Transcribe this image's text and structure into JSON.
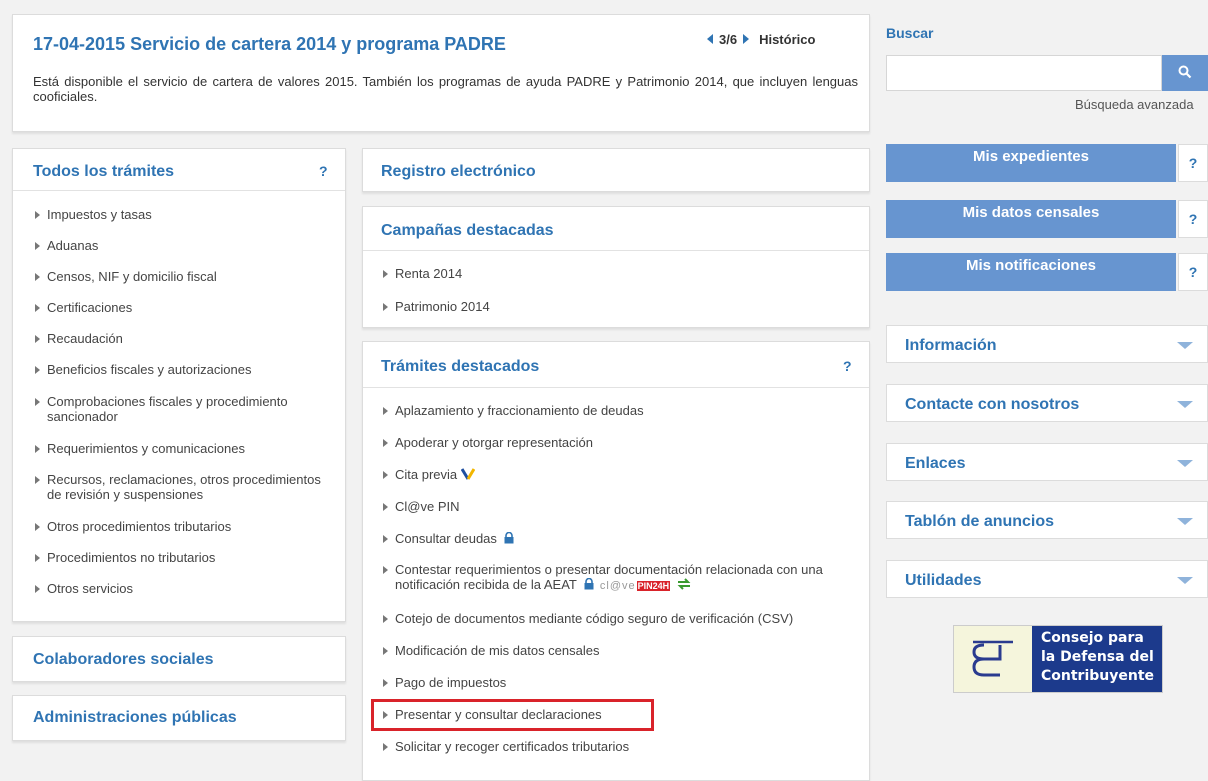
{
  "news": {
    "title": "17-04-2015 Servicio de cartera 2014 y programa PADRE",
    "pager": "3/6",
    "historico": "Histórico",
    "body": "Está disponible el servicio de cartera de valores 2015. También los programas de ayuda PADRE y Patrimonio 2014, que incluyen lenguas cooficiales."
  },
  "search": {
    "label": "Buscar",
    "placeholder": "",
    "advanced": "Búsqueda avanzada"
  },
  "left": {
    "title": "Todos los trámites",
    "help": "?",
    "items": [
      "Impuestos y tasas",
      "Aduanas",
      "Censos, NIF y domicilio fiscal",
      "Certificaciones",
      "Recaudación",
      "Beneficios fiscales y autorizaciones",
      "Comprobaciones fiscales y procedimiento sancionador",
      "Requerimientos y comunicaciones",
      "Recursos, reclamaciones, otros procedimientos de revisión y suspensiones",
      "Otros procedimientos tributarios",
      "Procedimientos no tributarios",
      "Otros servicios"
    ],
    "colaboradores": "Colaboradores sociales",
    "administraciones": "Administraciones públicas"
  },
  "middle": {
    "registro": "Registro electrónico",
    "campanas": {
      "title": "Campañas destacadas",
      "items": [
        "Renta 2014",
        "Patrimonio 2014"
      ]
    },
    "tramites": {
      "title": "Trámites destacados",
      "help": "?",
      "items": [
        "Aplazamiento y fraccionamiento de deudas",
        "Apoderar y otorgar representación",
        "Cita previa",
        "Cl@ve PIN",
        "Consultar deudas",
        "Contestar requerimientos o presentar documentación relacionada con una notificación recibida de la AEAT",
        "Cotejo de documentos mediante código seguro de verificación (CSV)",
        "Modificación de mis datos censales",
        "Pago de impuestos",
        "Presentar y consultar declaraciones",
        "Solicitar y recoger certificados tributarios"
      ],
      "clave_logo": "cl@ve",
      "pin24_logo": "PIN24H"
    }
  },
  "right": {
    "buttons": [
      "Mis expedientes",
      "Mis datos censales",
      "Mis notificaciones"
    ],
    "help": "?",
    "accordions": [
      "Información",
      "Contacte con nosotros",
      "Enlaces",
      "Tablón de anuncios",
      "Utilidades"
    ],
    "banner": "Consejo para la Defensa del Contribuyente"
  },
  "colors": {
    "link_blue": "#2f74b3",
    "button_blue": "#6795d0",
    "highlight_red": "#d9232a"
  }
}
